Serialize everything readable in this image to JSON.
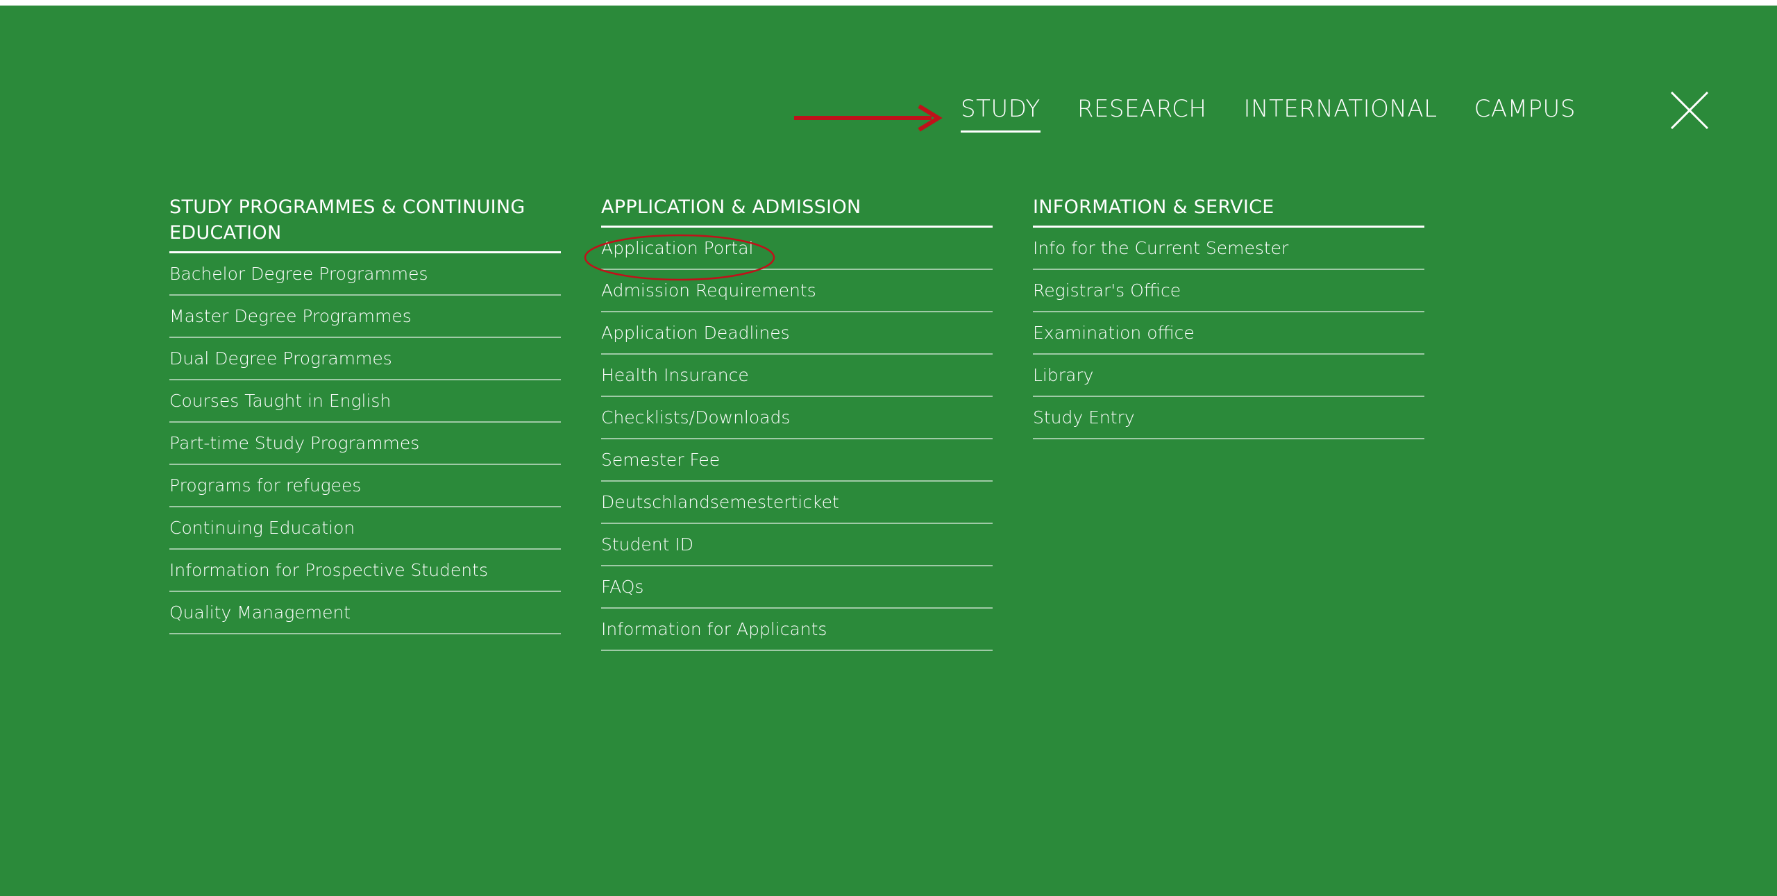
{
  "nav": {
    "items": [
      {
        "label": "STUDY",
        "active": true
      },
      {
        "label": "RESEARCH",
        "active": false
      },
      {
        "label": "INTERNATIONAL",
        "active": false
      },
      {
        "label": "CAMPUS",
        "active": false
      }
    ],
    "close_icon": "close-x-icon"
  },
  "columns": [
    {
      "header": "STUDY PROGRAMMES & CONTINUING EDUCATION",
      "items": [
        "Bachelor Degree Programmes",
        "Master Degree Programmes",
        "Dual Degree Programmes",
        "Courses Taught in English",
        "Part-time Study Programmes",
        "Programs for refugees",
        "Continuing Education",
        "Information for Prospective Students",
        "Quality Management"
      ]
    },
    {
      "header": "APPLICATION & ADMISSION",
      "items": [
        "Application Portal",
        "Admission Requirements",
        "Application Deadlines",
        "Health Insurance",
        "Checklists/Downloads",
        "Semester Fee",
        "Deutschlandsemesterticket",
        "Student ID",
        "FAQs",
        "Information for Applicants"
      ]
    },
    {
      "header": "INFORMATION & SERVICE",
      "items": [
        "Info for the Current Semester",
        "Registrar's Office",
        "Examination office",
        "Library",
        "Study Entry"
      ]
    }
  ],
  "colors": {
    "background": "#2b8a3a",
    "text": "#ffffff",
    "annotation": "#c0111a"
  }
}
